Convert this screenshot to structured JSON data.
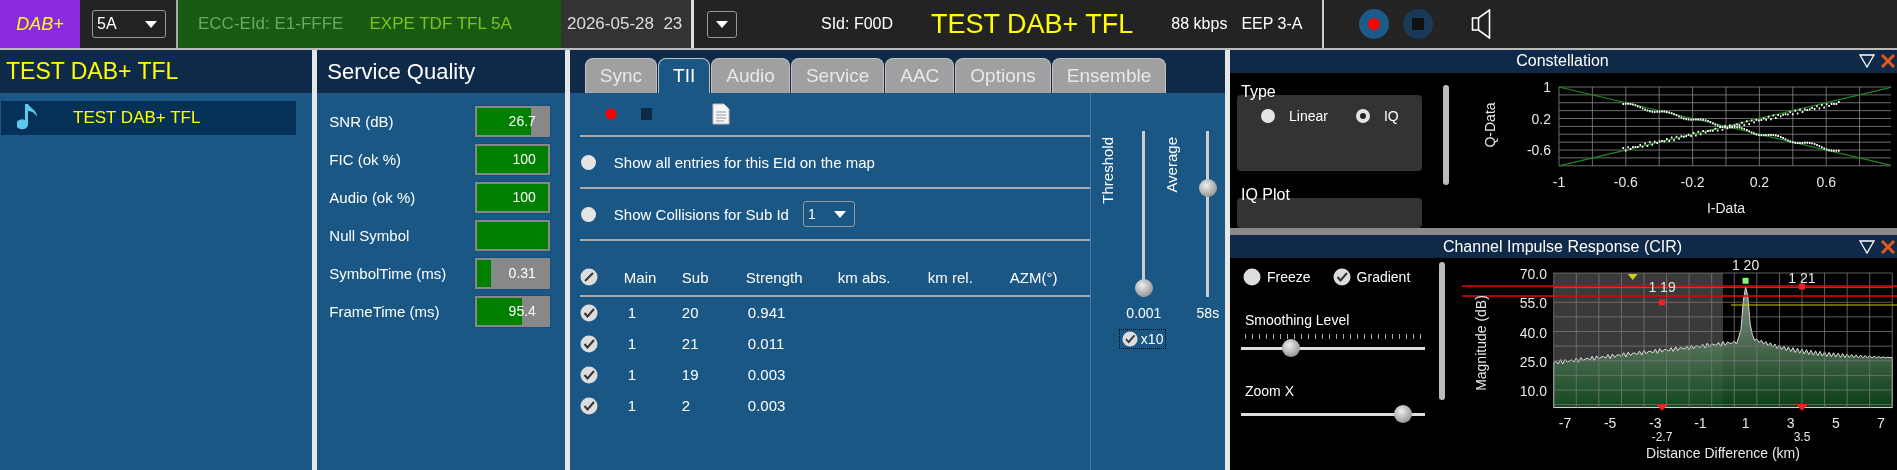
{
  "top_bar": {
    "mode_badge": "DAB+",
    "channel_select": {
      "value": "5A"
    },
    "ensemble_id": "ECC-EId: E1-FFFE",
    "ensemble_label": "EXPE TDF TFL 5A",
    "datetime": "2026-05-28  23",
    "service_id": "SId: F00D",
    "service_name": "TEST DAB+ TFL",
    "bitrate": "88 kbps",
    "protection": "EEP 3-A"
  },
  "services_panel": {
    "title": "TEST DAB+ TFL",
    "items": [
      {
        "label": "TEST DAB+ TFL",
        "selected": true
      }
    ]
  },
  "service_quality": {
    "title": "Service Quality",
    "metrics": [
      {
        "label": "SNR (dB)",
        "value": "26.7",
        "level": 0.76
      },
      {
        "label": "FIC (ok %)",
        "value": "100",
        "level": 1
      },
      {
        "label": "Audio (ok %)",
        "value": "100",
        "level": 1
      },
      {
        "label": "Null Symbol",
        "level": 1
      },
      {
        "label": "SymbolTime (ms)",
        "value": "0.31",
        "level": 0.2
      },
      {
        "label": "FrameTime (ms)",
        "value": "95.4",
        "level": 0.63
      }
    ]
  },
  "tabs": [
    {
      "label": "Sync",
      "selected": false
    },
    {
      "label": "TII",
      "selected": true
    },
    {
      "label": "Audio",
      "selected": false
    },
    {
      "label": "Service",
      "selected": false
    },
    {
      "label": "AAC",
      "selected": false
    },
    {
      "label": "Options",
      "selected": false
    },
    {
      "label": "Ensemble",
      "selected": false
    }
  ],
  "tii": {
    "options": [
      {
        "label": "Show all entries for this EId on the map",
        "selected": false
      },
      {
        "label": "Show Collisions for Sub Id",
        "selected": false,
        "select_value": "1"
      }
    ],
    "header_checkbox": {
      "checked": false
    },
    "columns": [
      "Main",
      "Sub",
      "Strength",
      "km abs.",
      "km rel.",
      "AZM(°)"
    ],
    "rows": [
      {
        "checked": true,
        "cells": [
          "1",
          "20",
          "0.941"
        ]
      },
      {
        "checked": true,
        "cells": [
          "1",
          "21",
          "0.011"
        ]
      },
      {
        "checked": true,
        "cells": [
          "1",
          "19",
          "0.003"
        ]
      },
      {
        "checked": true,
        "cells": [
          "1",
          "2",
          "0.003"
        ]
      }
    ],
    "threshold": {
      "label": "Threshold",
      "reading": "0.001",
      "level": 0
    },
    "average": {
      "label": "Average",
      "reading": "58s",
      "level": 0.6
    },
    "x10": {
      "label": "x10",
      "checked": true
    }
  },
  "constellation": {
    "title": "Constellation",
    "type_group": {
      "label": "Type",
      "options": [
        {
          "label": "Linear",
          "selected": false
        },
        {
          "label": "IQ",
          "selected": true
        }
      ]
    },
    "iq_plot_label": "IQ Plot",
    "y_label": "Q-Data",
    "x_label": "I-Data",
    "y_ticks": [
      "1",
      "0.2",
      "-0.6"
    ],
    "x_ticks": [
      "-1",
      "-0.6",
      "-0.2",
      "0.2",
      "0.6"
    ]
  },
  "cir": {
    "title": "Channel Impulse Response (CIR)",
    "freeze": {
      "label": "Freeze",
      "checked": false
    },
    "gradient": {
      "label": "Gradient",
      "checked": true
    },
    "smoothing": {
      "label": "Smoothing Level",
      "level": 0.27
    },
    "zoom_x": {
      "label": "Zoom X",
      "level": 0.88
    },
    "y_label": "Magnitude (dB)",
    "x_label": "Distance Difference (km)",
    "y_ticks": [
      "70.0",
      "55.0",
      "40.0",
      "25.0",
      "10.0"
    ],
    "x_ticks": [
      "-7",
      "-5",
      "-3",
      "-1",
      "1",
      "3",
      "5",
      "7"
    ],
    "markers": [
      {
        "label": "1 19",
        "distance": "-2.7"
      },
      {
        "label": "1 20"
      },
      {
        "label": "1 21",
        "distance": "3.5"
      }
    ]
  }
}
